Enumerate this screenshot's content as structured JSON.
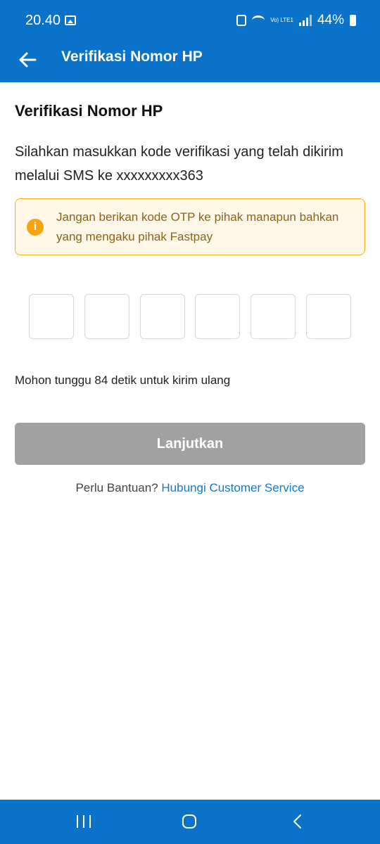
{
  "status_bar": {
    "time": "20.40",
    "battery_percent": "44%",
    "volte_label": "Vo) LTE1",
    "icons": [
      "gallery-icon",
      "alarm-icon",
      "wifi-icon",
      "volte-icon",
      "signal-icon",
      "battery-icon"
    ]
  },
  "app_bar": {
    "title": "Verifikasi Nomor HP",
    "back_icon": "arrow-left-icon",
    "background": "#0b72c9"
  },
  "content": {
    "heading": "Verifikasi Nomor HP",
    "description": "Silahkan masukkan kode verifikasi yang telah dikirim melalui SMS ke xxxxxxxxx363",
    "warning": {
      "icon": "info-icon",
      "text": "Jangan berikan kode OTP ke pihak manapun bahkan yang mengaku pihak Fastpay",
      "border_color": "#f4b41a",
      "background": "#fff8e8"
    },
    "otp": {
      "digits": [
        "",
        "",
        "",
        "",
        "",
        ""
      ]
    },
    "resend_text": "Mohon tunggu 84 detik untuk kirim ulang",
    "continue_label": "Lanjutkan",
    "continue_color": "#a1a1a1",
    "help_prefix": "Perlu Bantuan?",
    "help_link": "Hubungi Customer Service",
    "link_color": "#1679c3"
  },
  "nav_bar": {
    "icons": [
      "recent-apps-icon",
      "home-icon",
      "back-icon"
    ]
  }
}
